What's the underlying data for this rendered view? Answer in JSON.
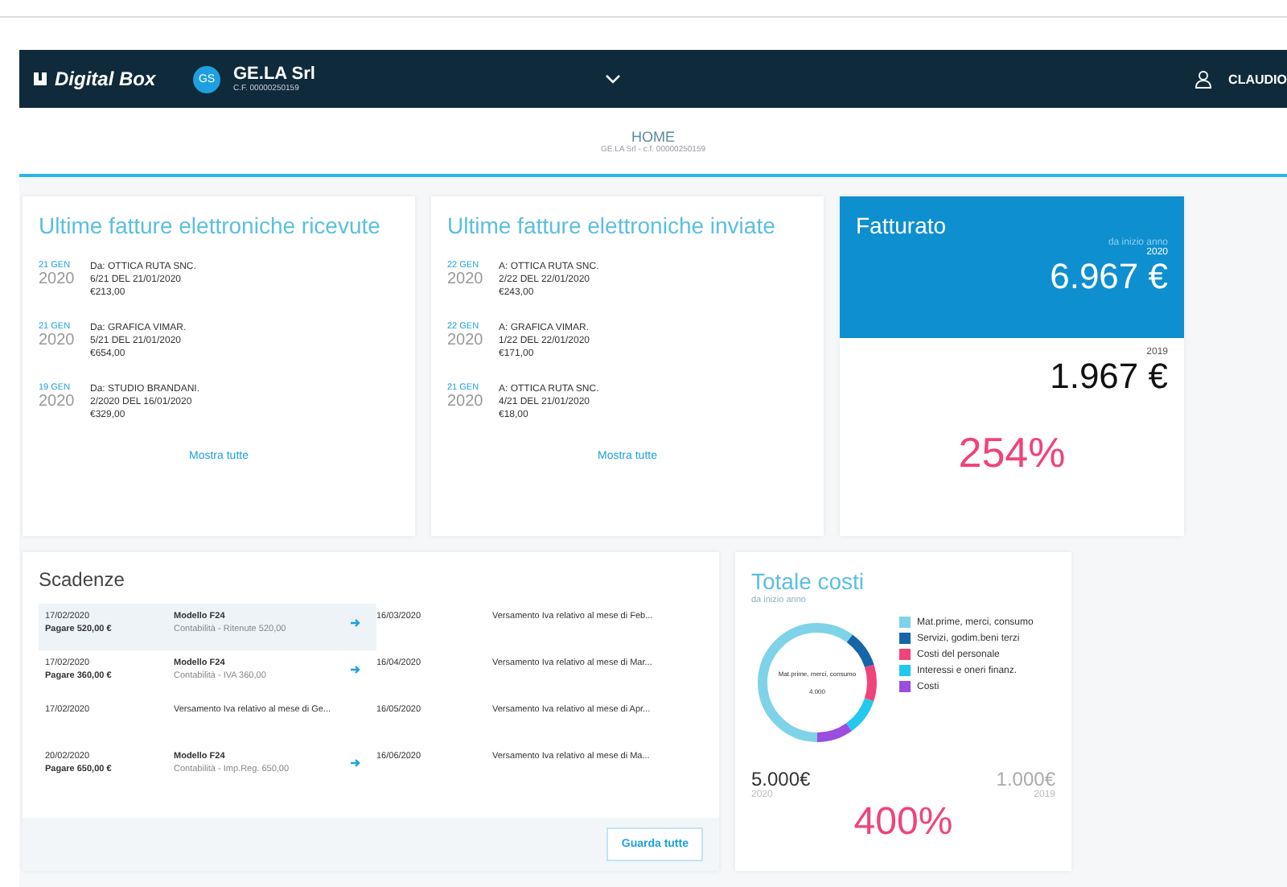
{
  "header": {
    "logo": "Digital Box",
    "company_initials": "GS",
    "company_name": "GE.LA Srl",
    "company_code": "C.F. 00000250159",
    "user": "CLAUDIO"
  },
  "breadcrumb": {
    "title": "HOME",
    "subtitle": "GE.LA Srl - c.f. 00000250159"
  },
  "received": {
    "title": "Ultime fatture elettroniche ricevute",
    "link": "Mostra tutte",
    "items": [
      {
        "day": "21 GEN",
        "year": "2020",
        "party": "Da: OTTICA RUTA SNC.",
        "number": "6/21 DEL 21/01/2020",
        "amount": "€213,00"
      },
      {
        "day": "21 GEN",
        "year": "2020",
        "party": "Da: GRAFICA VIMAR.",
        "number": "5/21 DEL 21/01/2020",
        "amount": "€654,00"
      },
      {
        "day": "19 GEN",
        "year": "2020",
        "party": "Da: STUDIO BRANDANI.",
        "number": "2/2020 DEL 16/01/2020",
        "amount": "€329,00"
      }
    ]
  },
  "sent": {
    "title": "Ultime fatture elettroniche inviate",
    "link": "Mostra tutte",
    "items": [
      {
        "day": "22 GEN",
        "year": "2020",
        "party": "A: OTTICA RUTA SNC.",
        "number": "2/22 DEL 22/01/2020",
        "amount": "€243,00"
      },
      {
        "day": "22 GEN",
        "year": "2020",
        "party": "A: GRAFICA VIMAR.",
        "number": "1/22 DEL 22/01/2020",
        "amount": "€171,00"
      },
      {
        "day": "21 GEN",
        "year": "2020",
        "party": "A: OTTICA RUTA SNC.",
        "number": "4/21 DEL 21/01/2020",
        "amount": "€18,00"
      }
    ]
  },
  "revenue": {
    "title": "Fatturato",
    "subtitle": "da inizio anno",
    "current_year": "2020",
    "current_value": "6.967 €",
    "previous_year": "2019",
    "previous_value": "1.967 €",
    "change": "254%"
  },
  "deadlines": {
    "title": "Scadenze",
    "button": "Guarda tutte",
    "left": [
      {
        "date": "17/02/2020",
        "amount": "Pagare 520,00 €",
        "title": "Modello F24",
        "detail": "Contabilità - Ritenute 520,00",
        "arrow": true,
        "selected": true
      },
      {
        "date": "17/02/2020",
        "amount": "Pagare 360,00 €",
        "title": "Modello F24",
        "detail": "Contabilità - IVA 360,00",
        "arrow": true,
        "selected": false
      },
      {
        "date": "17/02/2020",
        "title": "Versamento Iva relativo al mese di Ge...",
        "arrow": false,
        "selected": false
      },
      {
        "date": "20/02/2020",
        "amount": "Pagare 650,00 €",
        "title": "Modello F24",
        "detail": "Contabilità - Imp.Reg. 650,00",
        "arrow": true,
        "selected": false
      }
    ],
    "right": [
      {
        "date": "16/03/2020",
        "title": "Versamento Iva relativo al mese di Feb..."
      },
      {
        "date": "16/04/2020",
        "title": "Versamento Iva relativo al mese di Mar..."
      },
      {
        "date": "16/05/2020",
        "title": "Versamento Iva relativo al mese di Apr..."
      },
      {
        "date": "16/06/2020",
        "title": "Versamento Iva relativo al mese di Ma..."
      }
    ]
  },
  "costs": {
    "title": "Totale costi",
    "subtitle": "da inizio anno",
    "donut_label": "Mat.prime, merci, consumo",
    "donut_value": "4.000",
    "legend": [
      {
        "label": "Mat.prime, merci, consumo",
        "color": "#7fd3e8"
      },
      {
        "label": "Servizi, godim.beni terzi",
        "color": "#1565a8"
      },
      {
        "label": "Costi del personale",
        "color": "#f0437a"
      },
      {
        "label": "Interessi e oneri finanz.",
        "color": "#22c8ee"
      },
      {
        "label": "Costi",
        "color": "#9b4de0"
      }
    ],
    "current_value": "5.000€",
    "current_year": "2020",
    "previous_value": "1.000€",
    "previous_year": "2019",
    "change": "400%"
  }
}
